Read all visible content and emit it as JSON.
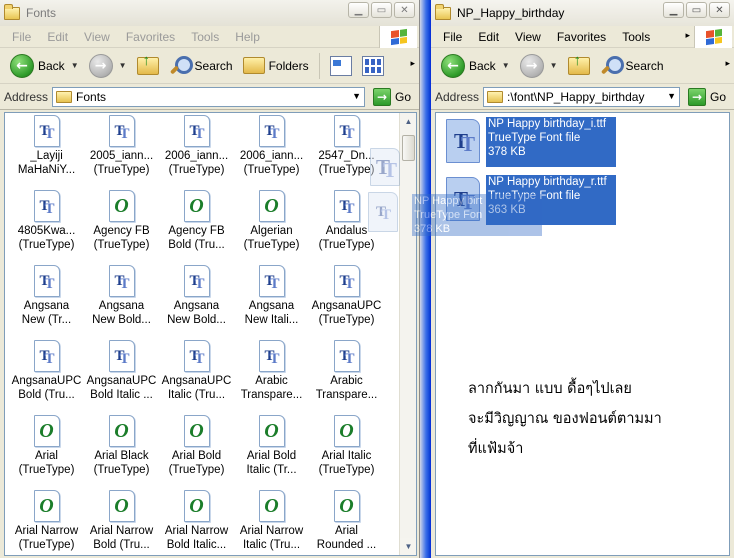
{
  "left_window": {
    "title": "Fonts",
    "menu": [
      "File",
      "Edit",
      "View",
      "Favorites",
      "Tools",
      "Help"
    ],
    "toolbar": {
      "back": "Back",
      "search": "Search",
      "folders": "Folders"
    },
    "address_label": "Address",
    "address_value": "Fonts",
    "go": "Go",
    "files": [
      {
        "icon": "truetype-font-icon",
        "line1": "_Layiji",
        "line2": "MaHaNiY..."
      },
      {
        "icon": "truetype-font-icon",
        "line1": "2005_iann...",
        "line2": "(TrueType)"
      },
      {
        "icon": "truetype-font-icon",
        "line1": "2006_iann...",
        "line2": "(TrueType)"
      },
      {
        "icon": "truetype-font-icon",
        "line1": "2006_iann...",
        "line2": "(TrueType)"
      },
      {
        "icon": "truetype-font-icon",
        "line1": "2547_Dn...",
        "line2": "(TrueType)"
      },
      {
        "icon": "truetype-font-icon",
        "line1": "4805Kwa...",
        "line2": "(TrueType)"
      },
      {
        "icon": "opentype-font-icon",
        "line1": "Agency FB",
        "line2": "(TrueType)"
      },
      {
        "icon": "opentype-font-icon",
        "line1": "Agency FB",
        "line2": "Bold (Tru..."
      },
      {
        "icon": "opentype-font-icon",
        "line1": "Algerian",
        "line2": "(TrueType)"
      },
      {
        "icon": "truetype-font-icon",
        "line1": "Andalus",
        "line2": "(TrueType)"
      },
      {
        "icon": "truetype-font-icon",
        "line1": "Angsana",
        "line2": "New (Tr..."
      },
      {
        "icon": "truetype-font-icon",
        "line1": "Angsana",
        "line2": "New Bold..."
      },
      {
        "icon": "truetype-font-icon",
        "line1": "Angsana",
        "line2": "New Bold..."
      },
      {
        "icon": "truetype-font-icon",
        "line1": "Angsana",
        "line2": "New Itali..."
      },
      {
        "icon": "truetype-font-icon",
        "line1": "AngsanaUPC",
        "line2": "(TrueType)"
      },
      {
        "icon": "truetype-font-icon",
        "line1": "AngsanaUPC",
        "line2": "Bold (Tru..."
      },
      {
        "icon": "truetype-font-icon",
        "line1": "AngsanaUPC",
        "line2": "Bold Italic ..."
      },
      {
        "icon": "truetype-font-icon",
        "line1": "AngsanaUPC",
        "line2": "Italic (Tru..."
      },
      {
        "icon": "truetype-font-icon",
        "line1": "Arabic",
        "line2": "Transpare..."
      },
      {
        "icon": "truetype-font-icon",
        "line1": "Arabic",
        "line2": "Transpare..."
      },
      {
        "icon": "opentype-font-icon",
        "line1": "Arial",
        "line2": "(TrueType)"
      },
      {
        "icon": "opentype-font-icon",
        "line1": "Arial Black",
        "line2": "(TrueType)"
      },
      {
        "icon": "opentype-font-icon",
        "line1": "Arial Bold",
        "line2": "(TrueType)"
      },
      {
        "icon": "opentype-font-icon",
        "line1": "Arial Bold",
        "line2": "Italic (Tr..."
      },
      {
        "icon": "opentype-font-icon",
        "line1": "Arial Italic",
        "line2": "(TrueType)"
      },
      {
        "icon": "opentype-font-icon",
        "line1": "Arial Narrow",
        "line2": "(TrueType)"
      },
      {
        "icon": "opentype-font-icon",
        "line1": "Arial Narrow",
        "line2": "Bold (Tru..."
      },
      {
        "icon": "opentype-font-icon",
        "line1": "Arial Narrow",
        "line2": "Bold Italic..."
      },
      {
        "icon": "opentype-font-icon",
        "line1": "Arial Narrow",
        "line2": "Italic (Tru..."
      },
      {
        "icon": "opentype-font-icon",
        "line1": "Arial",
        "line2": "Rounded ..."
      }
    ]
  },
  "right_window": {
    "title": "NP_Happy_birthday",
    "menu": [
      "File",
      "Edit",
      "View",
      "Favorites",
      "Tools"
    ],
    "toolbar": {
      "back": "Back",
      "search": "Search"
    },
    "address_label": "Address",
    "address_value": ":\\font\\NP_Happy_birthday",
    "go": "Go",
    "files": [
      {
        "name": "NP Happy birthday_i.ttf",
        "type": "TrueType Font file",
        "size": "378 KB"
      },
      {
        "name": "NP Happy birthday_r.ttf",
        "type": "TrueType Font file",
        "size": "363 KB"
      }
    ],
    "drag_ghost": {
      "name": "NP Happy birt",
      "type": "TrueType Fon",
      "size": "378 KB"
    },
    "note_lines": [
      "ลากกันมา แบบ ดื้อๆไปเลย",
      "จะมีวิญญาณ ของฟอนต์ตามมา",
      "ที่แฟ้มจ้า"
    ]
  }
}
